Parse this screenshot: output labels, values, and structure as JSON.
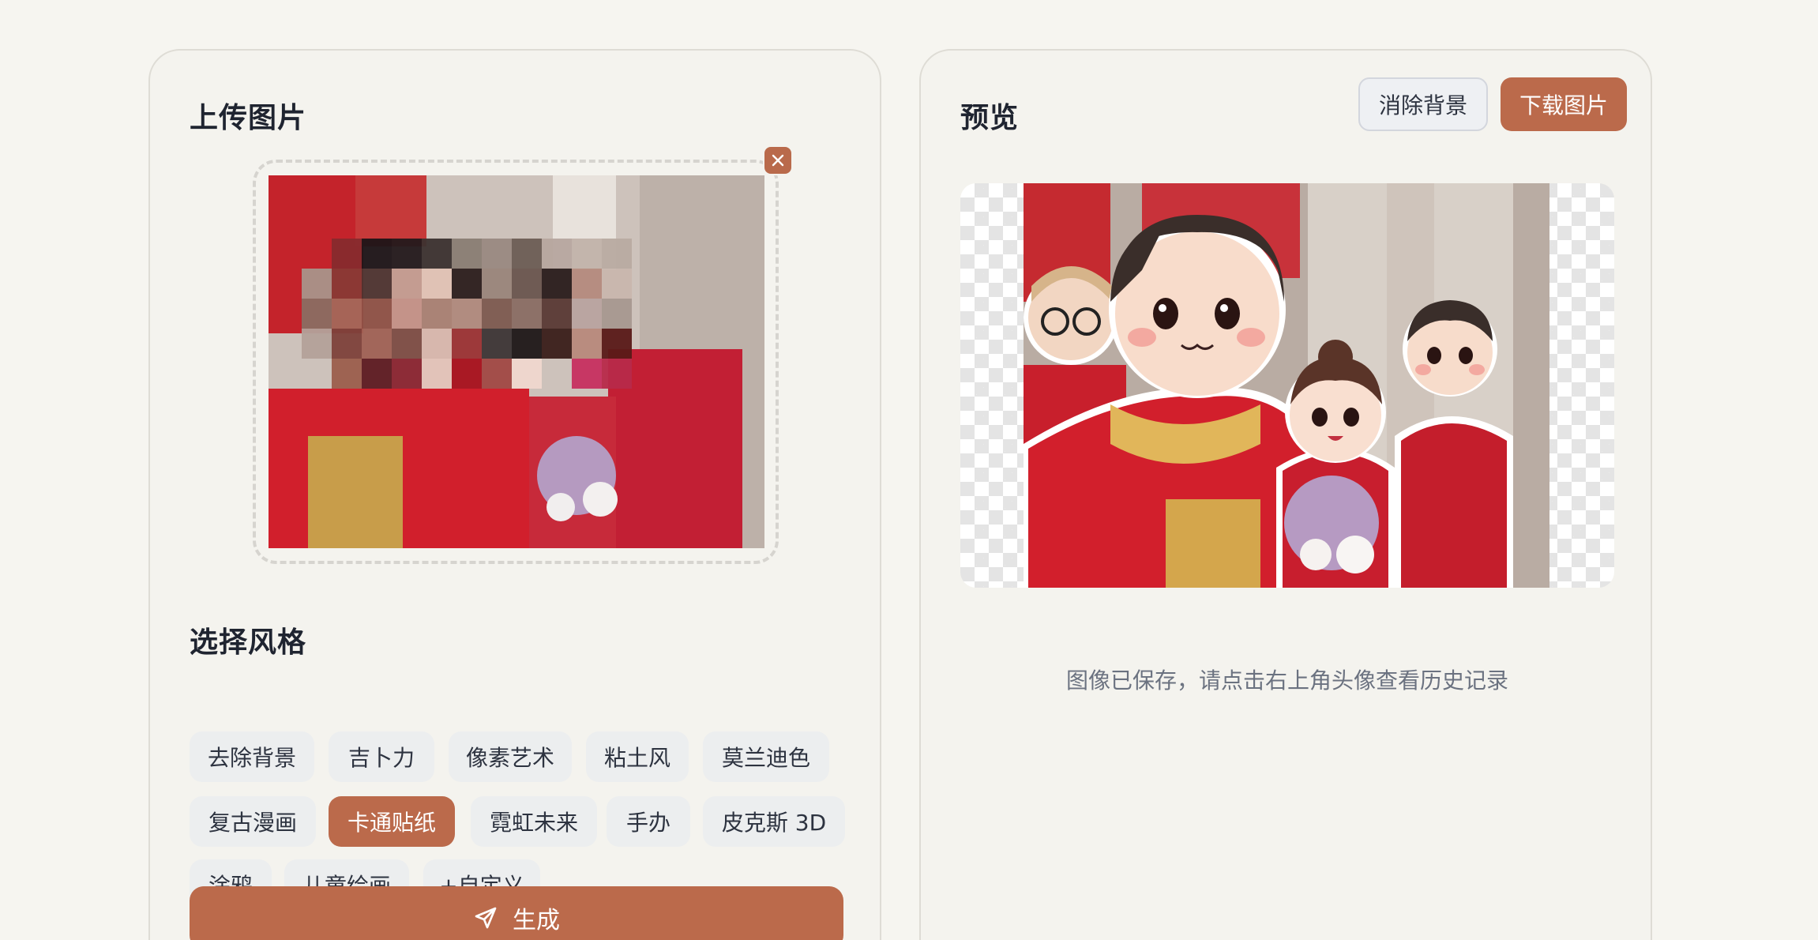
{
  "upload": {
    "title": "上传图片",
    "remove_icon": "close-icon"
  },
  "styles": {
    "title": "选择风格",
    "options": [
      "去除背景",
      "吉卜力",
      "像素艺术",
      "粘土风",
      "莫兰迪色",
      "复古漫画",
      "卡通贴纸",
      "霓虹未来",
      "手办",
      "皮克斯 3D",
      "涂鸦",
      "儿童绘画",
      "+自定义"
    ],
    "selected": "卡通贴纸"
  },
  "generate": {
    "label": "生成",
    "icon": "send-icon"
  },
  "preview": {
    "title": "预览",
    "remove_bg_label": "消除背景",
    "download_label": "下载图片",
    "save_hint": "图像已保存，请点击右上角头像查看历史记录"
  },
  "colors": {
    "accent": "#bb6a4b",
    "background": "#f6f5f0",
    "chip": "#eceeef"
  }
}
